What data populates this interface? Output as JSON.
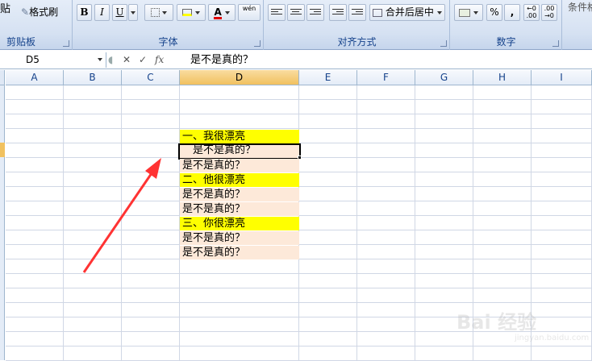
{
  "ribbon": {
    "clipboard": {
      "paste_label": "贴",
      "format_painter_label": "格式刷",
      "group_label": "剪贴板"
    },
    "font": {
      "bold": "B",
      "italic": "I",
      "underline": "U",
      "font_color_glyph": "A",
      "phonetic_glyph": "wén",
      "group_label": "字体"
    },
    "alignment": {
      "merge_center_label": "合并后居中",
      "group_label": "对齐方式"
    },
    "number": {
      "percent": "%",
      "comma": ",",
      "group_label": "数字"
    },
    "styles": {
      "conditional_label": "条件格"
    }
  },
  "formula_bar": {
    "name_box": "D5",
    "cancel": "✕",
    "confirm": "✓",
    "fx": "fx",
    "content": "是不是真的？"
  },
  "columns": [
    "A",
    "B",
    "C",
    "D",
    "E",
    "F",
    "G",
    "H",
    "I"
  ],
  "selected_column": "D",
  "cells": [
    {
      "ref": "D4",
      "text": "一、我很漂亮",
      "fill": "yellow"
    },
    {
      "ref": "D5",
      "text": "是不是真的？",
      "fill": "peach",
      "active": true
    },
    {
      "ref": "D6",
      "text": "是不是真的？",
      "fill": "peach"
    },
    {
      "ref": "D7",
      "text": "二、他很漂亮",
      "fill": "yellow"
    },
    {
      "ref": "D8",
      "text": "是不是真的？",
      "fill": "peach"
    },
    {
      "ref": "D9",
      "text": "是不是真的？",
      "fill": "peach"
    },
    {
      "ref": "D10",
      "text": "三、你很漂亮",
      "fill": "yellow"
    },
    {
      "ref": "D11",
      "text": "是不是真的？",
      "fill": "peach"
    },
    {
      "ref": "D12",
      "text": "是不是真的？",
      "fill": "peach"
    }
  ],
  "colors": {
    "highlight": "#ffff00",
    "peach": "#fde9d9",
    "arrow": "#ff3333",
    "selected_header": "#f1c15f"
  },
  "watermark": {
    "logo_text": "Bai 经验",
    "url": "jingyan.baidu.com"
  }
}
